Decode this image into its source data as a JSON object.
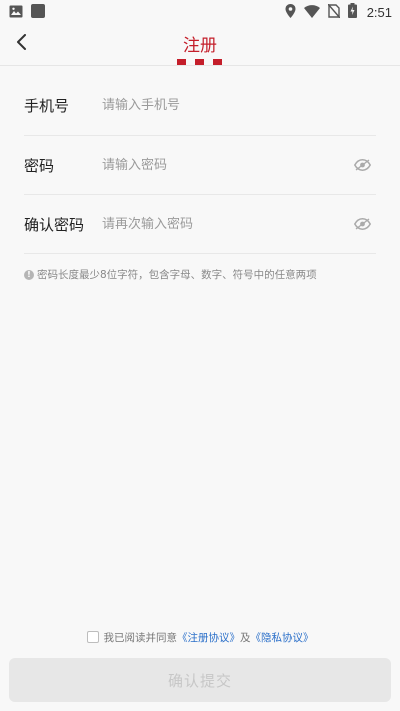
{
  "status_bar": {
    "time": "2:51",
    "left_icons": [
      "image-icon",
      "app-square-icon"
    ],
    "right_icons": [
      "location-icon",
      "wifi-icon",
      "no-sim-icon",
      "battery-charging-icon"
    ]
  },
  "header": {
    "title": "注册",
    "back_icon": "chevron-left-icon",
    "accent_color": "#c41e2a"
  },
  "form": {
    "phone": {
      "label": "手机号",
      "placeholder": "请输入手机号"
    },
    "password": {
      "label": "密码",
      "placeholder": "请输入密码",
      "toggle_icon": "eye-icon"
    },
    "confirm_password": {
      "label": "确认密码",
      "placeholder": "请再次输入密码",
      "toggle_icon": "eye-icon"
    }
  },
  "hint": {
    "icon": "info-icon",
    "text": "密码长度最少8位字符，包含字母、数字、符号中的任意两项"
  },
  "agreement": {
    "checked": false,
    "prefix": "我已阅读并同意",
    "register_link": "《注册协议》",
    "conjunction": "及",
    "privacy_link": "《隐私协议》"
  },
  "submit": {
    "label": "确认提交"
  }
}
